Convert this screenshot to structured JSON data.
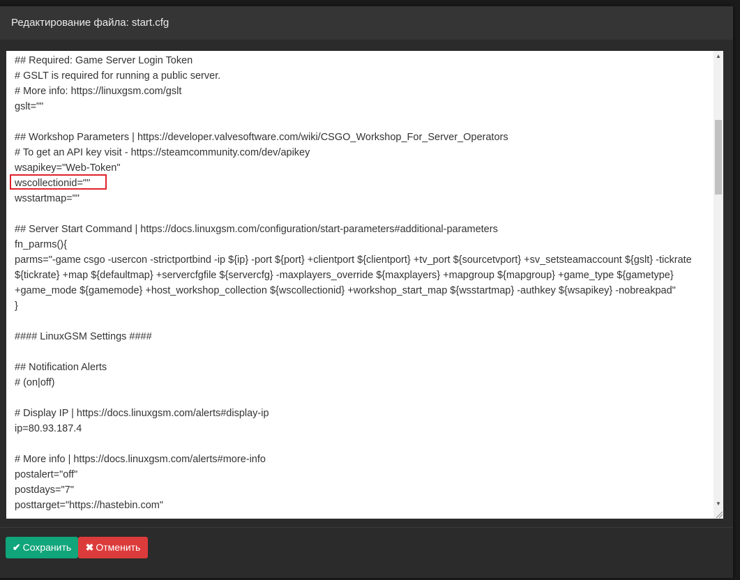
{
  "dialog": {
    "title": "Редактирование файла: start.cfg"
  },
  "editor": {
    "lines": [
      "## Required: Game Server Login Token",
      "# GSLT is required for running a public server.",
      "# More info: https://linuxgsm.com/gslt",
      "gslt=\"\"",
      "",
      "## Workshop Parameters | https://developer.valvesoftware.com/wiki/CSGO_Workshop_For_Server_Operators",
      "# To get an API key visit - https://steamcommunity.com/dev/apikey",
      "wsapikey=\"Web-Token\"",
      "wscollectionid=\"\"",
      "wsstartmap=\"\"",
      "",
      "## Server Start Command | https://docs.linuxgsm.com/configuration/start-parameters#additional-parameters",
      "fn_parms(){",
      "parms=\"-game csgo -usercon -strictportbind -ip ${ip} -port ${port} +clientport ${clientport} +tv_port ${sourcetvport} +sv_setsteamaccount ${gslt} -tickrate ${tickrate} +map ${defaultmap} +servercfgfile ${servercfg} -maxplayers_override ${maxplayers} +mapgroup ${mapgroup} +game_type ${gametype} +game_mode ${gamemode} +host_workshop_collection ${wscollectionid} +workshop_start_map ${wsstartmap} -authkey ${wsapikey} -nobreakpad\"",
      "}",
      "",
      "#### LinuxGSM Settings ####",
      "",
      "## Notification Alerts",
      "# (on|off)",
      "",
      "# Display IP | https://docs.linuxgsm.com/alerts#display-ip",
      "ip=80.93.187.4",
      "",
      "# More info | https://docs.linuxgsm.com/alerts#more-info",
      "postalert=\"off\"",
      "postdays=\"7\"",
      "posttarget=\"https://hastebin.com\""
    ]
  },
  "footer": {
    "save_label": "Сохранить",
    "cancel_label": "Отменить"
  },
  "icons": {
    "save": "check-icon",
    "cancel": "close-icon"
  },
  "colors": {
    "save": "#10a57a",
    "cancel": "#dc3b3b",
    "highlight": "#e0222b"
  }
}
